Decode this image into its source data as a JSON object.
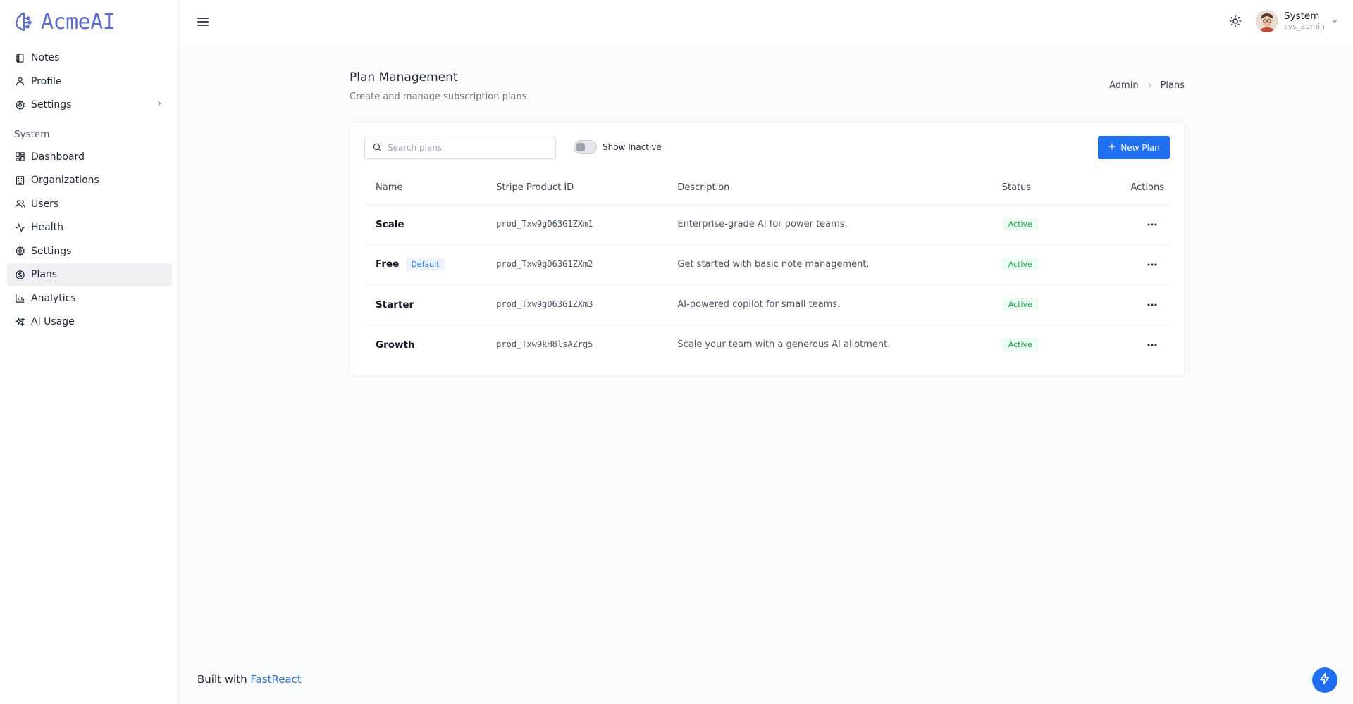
{
  "brand": {
    "logo_text": "AcmeAI",
    "accent_color": "#5b6bd5"
  },
  "sidebar": {
    "top_items": [
      {
        "label": "Notes",
        "icon": "notebook-icon"
      },
      {
        "label": "Profile",
        "icon": "user-icon"
      },
      {
        "label": "Settings",
        "icon": "gear-icon",
        "has_submenu": true
      }
    ],
    "section_label": "System",
    "system_items": [
      {
        "label": "Dashboard",
        "icon": "dashboard-icon"
      },
      {
        "label": "Organizations",
        "icon": "building-icon"
      },
      {
        "label": "Users",
        "icon": "users-icon"
      },
      {
        "label": "Health",
        "icon": "activity-icon"
      },
      {
        "label": "Settings",
        "icon": "gear-icon"
      },
      {
        "label": "Plans",
        "icon": "dollar-circle-icon",
        "active": true
      },
      {
        "label": "Analytics",
        "icon": "bar-chart-icon"
      },
      {
        "label": "AI Usage",
        "icon": "sparkles-icon"
      }
    ]
  },
  "topbar": {
    "user": {
      "name": "System",
      "handle": "sys_admin"
    }
  },
  "page": {
    "title": "Plan Management",
    "subtitle": "Create and manage subscription plans",
    "breadcrumb": [
      "Admin",
      "Plans"
    ]
  },
  "toolbar": {
    "search_placeholder": "Search plans",
    "search_value": "",
    "toggle_label": "Show Inactive",
    "toggle_on": false,
    "new_button_label": "New Plan",
    "primary_color": "#1f6ff0"
  },
  "table": {
    "columns": [
      "Name",
      "Stripe Product ID",
      "Description",
      "Status",
      "Actions"
    ],
    "rows": [
      {
        "name": "Scale",
        "badge": "",
        "stripe_id": "prod_Txw9gD63G1ZXm1",
        "description": "Enterprise-grade AI for power teams.",
        "status": "Active"
      },
      {
        "name": "Free",
        "badge": "Default",
        "stripe_id": "prod_Txw9gD63G1ZXm2",
        "description": "Get started with basic note management.",
        "status": "Active"
      },
      {
        "name": "Starter",
        "badge": "",
        "stripe_id": "prod_Txw9gD63G1ZXm3",
        "description": "AI-powered copilot for small teams.",
        "status": "Active"
      },
      {
        "name": "Growth",
        "badge": "",
        "stripe_id": "prod_Txw9kH8lsAZrg5",
        "description": "Scale your team with a generous AI allotment.",
        "status": "Active"
      }
    ]
  },
  "footer": {
    "prefix": "Built with",
    "link": "FastReact"
  }
}
